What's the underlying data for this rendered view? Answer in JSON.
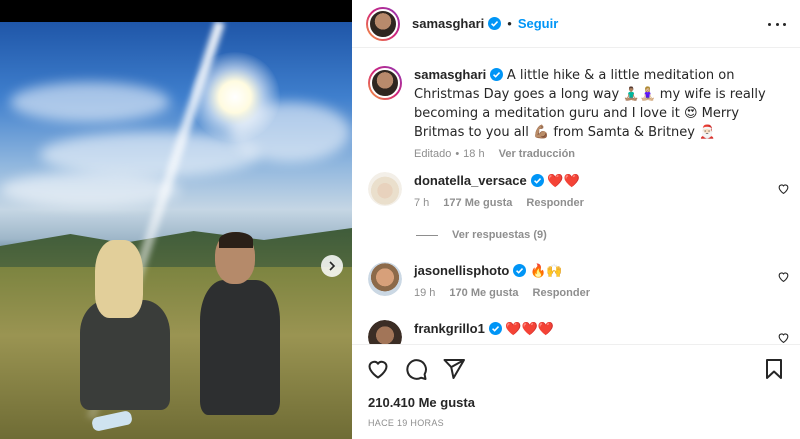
{
  "post": {
    "author": "samasghari",
    "follow_label": "Seguir",
    "dot": "•",
    "caption": {
      "username": "samasghari",
      "text": "A little hike & a little meditation on Christmas Day goes a long way 🧘🏽‍♂️🧘🏼‍♀️ my wife is really becoming a meditation guru and I love it 😍 Merry Britmas to you all 💪🏽 from Samta & Britney 🎅🏻",
      "edited": "Editado",
      "time": "18 h",
      "translate": "Ver traducción"
    },
    "comments": [
      {
        "username": "donatella_versace",
        "text": "❤️❤️",
        "time": "7 h",
        "likes": "177 Me gusta",
        "reply": "Responder",
        "replies": "Ver respuestas (9)"
      },
      {
        "username": "jasonellisphoto",
        "text": "🔥🙌",
        "time": "19 h",
        "likes": "170 Me gusta",
        "reply": "Responder"
      },
      {
        "username": "frankgrillo1",
        "text": "❤️❤️❤️"
      }
    ],
    "likes_total": "210.410 Me gusta",
    "posted_ago": "HACE 19 HORAS"
  },
  "icons": {
    "verified": "verified-badge-icon",
    "more": "more-options-icon",
    "like": "heart-icon",
    "comment": "comment-icon",
    "share": "share-icon",
    "save": "bookmark-icon",
    "next": "chevron-right-icon"
  },
  "colors": {
    "accent": "#0095f6",
    "text": "#262626",
    "muted": "#8e8e8e"
  }
}
